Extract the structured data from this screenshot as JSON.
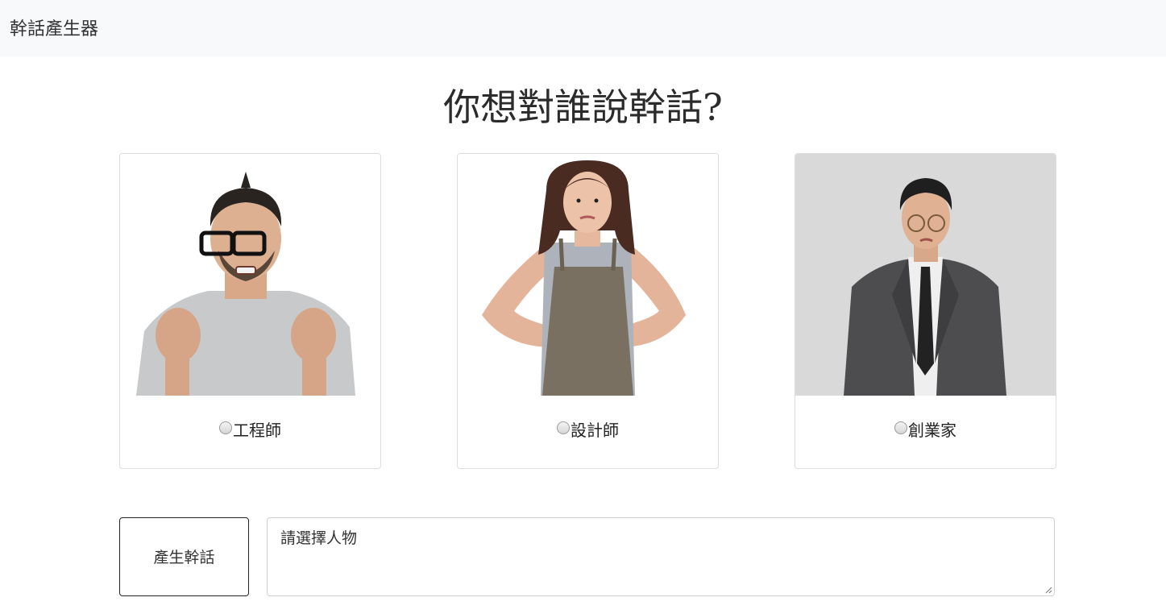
{
  "navbar": {
    "brand": "幹話產生器"
  },
  "main": {
    "heading": "你想對誰說幹話?",
    "characters": [
      {
        "label": "工程師",
        "icon": "angry-engineer-photo"
      },
      {
        "label": "設計師",
        "icon": "annoyed-designer-photo"
      },
      {
        "label": "創業家",
        "icon": "skeptical-entrepreneur-photo"
      }
    ],
    "generate_button": "產生幹話",
    "output_text": "請選擇人物"
  }
}
